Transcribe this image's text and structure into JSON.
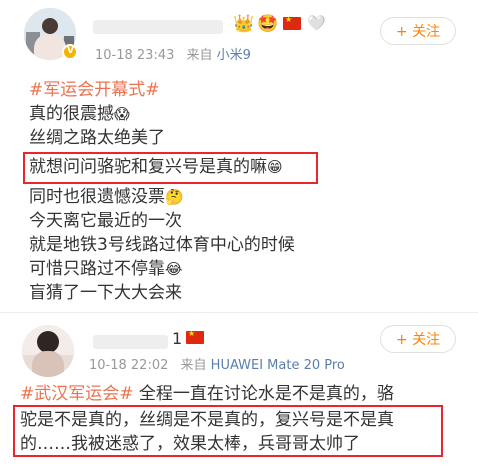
{
  "post1": {
    "time": "10-18 23:43",
    "source_prefix": "来自",
    "device": "小米9",
    "follow_label": "+ 关注",
    "hashtag": "#军运会开幕式#",
    "lines": [
      "真的很震撼",
      "丝绸之路太绝美了",
      "就想问问骆驼和复兴号是真的嘛",
      "同时也很遗憾没票",
      "今天离它最近的一次",
      "就是地铁3号线路过体育中心的时候",
      "可惜只路过不停靠",
      "盲猜了一下大大会来"
    ],
    "line_emojis": [
      "😱",
      "",
      "😁",
      "🤔",
      "",
      "",
      "😂",
      ""
    ]
  },
  "post2": {
    "name_suffix": "1",
    "time": "10-18 22:02",
    "source_prefix": "来自",
    "device": "HUAWEI Mate 20 Pro",
    "follow_label": "+ 关注",
    "hashtag": "#武汉军运会#",
    "lines": [
      "全程一直在讨论水是不是真的，骆",
      "驼是不是真的，丝绸是不是真的，复兴号是不是真",
      "的……我被迷惑了，效果太棒，兵哥哥太帅了"
    ]
  },
  "colors": {
    "accent": "#ff8200",
    "hashtag": "#eb7350",
    "highlight_box": "#e8262c",
    "device_link": "#5a7fad"
  }
}
